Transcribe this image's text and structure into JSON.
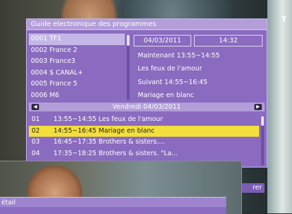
{
  "epg": {
    "title": "Guide electronique des programmes",
    "date": "04/03/2011",
    "time": "14:32",
    "channels": [
      "0001 TF1",
      "0002 France 2",
      "0003 France3",
      "0004 $ CANAL+",
      "0005 France 5",
      "0006 M6"
    ],
    "info": {
      "now_label": "Maintenant 13:55~14:55",
      "now_title": "Les feux de l'amour",
      "next_label": "Suivant 14:55~16:45",
      "next_title": "Mariage en blanc"
    },
    "day_label": "Vendredi 04/03/2011",
    "programs": [
      {
        "num": "01",
        "text": "13:55~14:55 Les feux de l'amour"
      },
      {
        "num": "02",
        "text": "14:55~16:45 Mariage en blanc"
      },
      {
        "num": "03",
        "text": "16:45~17:35 Brothers & sisters...."
      },
      {
        "num": "04",
        "text": "17:35~18:25 Brothers & sisters. \"La..."
      }
    ]
  },
  "inset": {
    "bar_label": "étail",
    "partial_button": "rer"
  },
  "overlay": {
    "tv_logo": "T"
  }
}
